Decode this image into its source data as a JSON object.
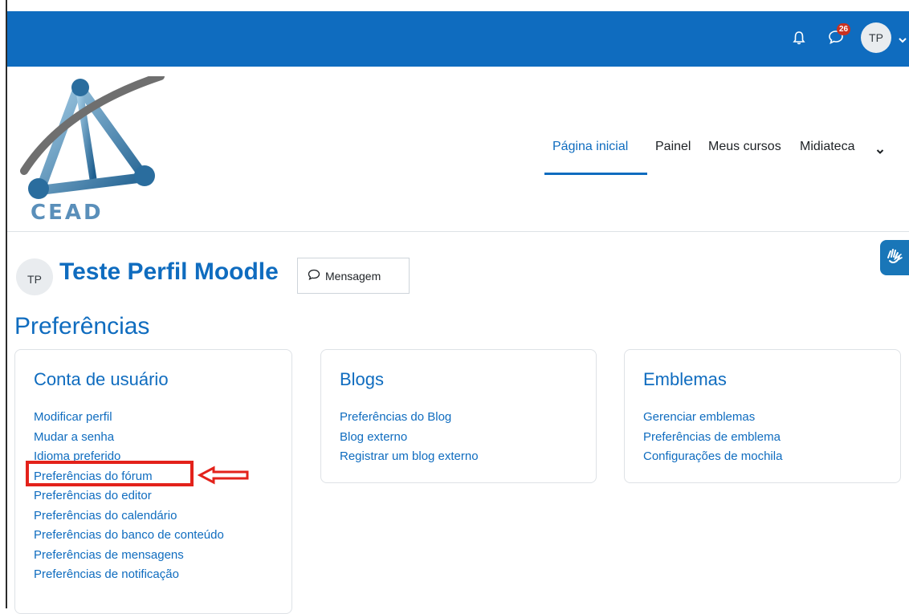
{
  "topbar": {
    "notification_count": "26",
    "user_initials": "TP",
    "icons": [
      "bell-icon",
      "chat-icon",
      "chevron-down-icon"
    ],
    "bg_color": "#0f6cbf"
  },
  "logo": {
    "text": "CEAD"
  },
  "nav": {
    "items": [
      {
        "label": "Página inicial",
        "active": true
      },
      {
        "label": "Painel"
      },
      {
        "label": "Meus cursos"
      },
      {
        "label": "Midiateca"
      }
    ]
  },
  "profile": {
    "initials": "TP",
    "name": "Teste Perfil Moodle",
    "message_button": "Mensagem"
  },
  "page_title": "Preferências",
  "cards": [
    {
      "title": "Conta de usuário",
      "links": [
        "Modificar perfil",
        "Mudar a senha",
        "Idioma preferido",
        "Preferências do fórum",
        "Preferências do editor",
        "Preferências do calendário",
        "Preferências do banco de conteúdo",
        "Preferências de mensagens",
        "Preferências de notificação"
      ]
    },
    {
      "title": "Blogs",
      "links": [
        "Preferências do Blog",
        "Blog externo",
        "Registrar um blog externo"
      ]
    },
    {
      "title": "Emblemas",
      "links": [
        "Gerenciar emblemas",
        "Preferências de emblema",
        "Configurações de mochila"
      ]
    }
  ],
  "annotation": {
    "highlight_color": "#e3221b"
  }
}
